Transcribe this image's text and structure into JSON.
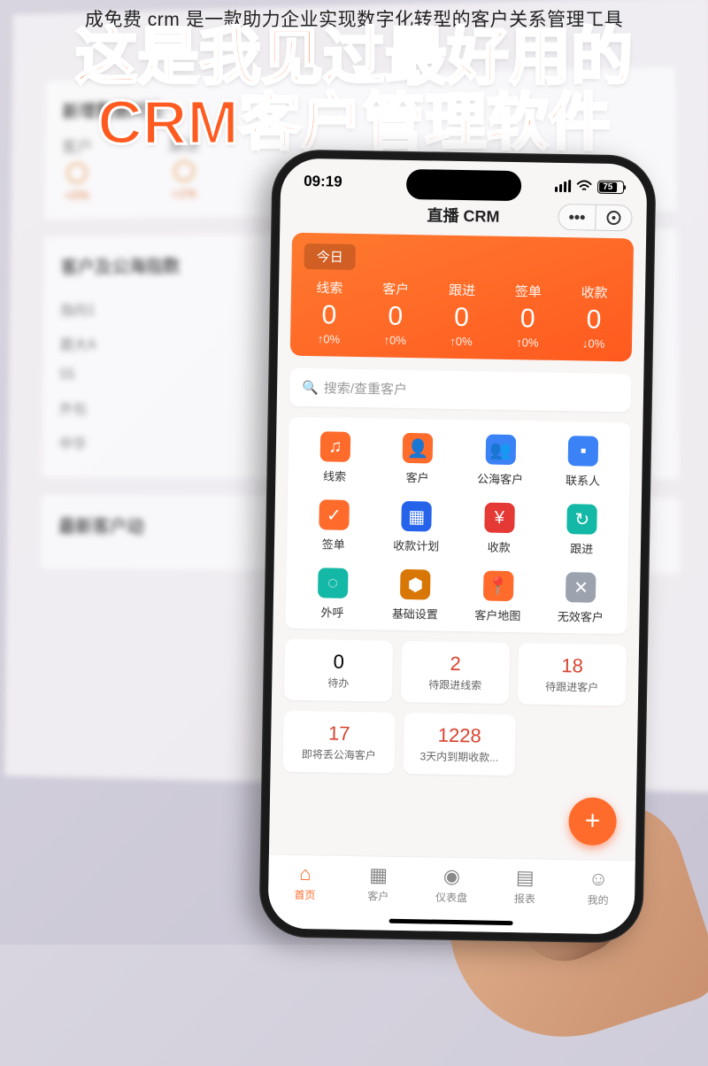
{
  "caption": {
    "small": "成免费 crm 是一款助力企业实现数字化转型的客户关系管理工具",
    "line1": "这是我见过最好用的",
    "line2": "CRM客户管理软件"
  },
  "bg": {
    "section1_title": "新增数据对比",
    "cols": [
      {
        "label": "客户",
        "pct": "+0%"
      },
      {
        "label": "跟进",
        "pct": "+1%"
      }
    ],
    "section2_title": "客户及公海指数",
    "rows": [
      "指向1",
      "跟大A",
      "55",
      "外包",
      "中华"
    ],
    "section3_title": "最新客户动"
  },
  "phone": {
    "status": {
      "time": "09:19",
      "battery": "75"
    },
    "app_title": "直播 CRM",
    "today_label": "今日",
    "stats": [
      {
        "label": "线索",
        "value": "0",
        "pct": "↑0%"
      },
      {
        "label": "客户",
        "value": "0",
        "pct": "↑0%"
      },
      {
        "label": "跟进",
        "value": "0",
        "pct": "↑0%"
      },
      {
        "label": "签单",
        "value": "0",
        "pct": "↑0%"
      },
      {
        "label": "收款",
        "value": "0",
        "pct": "↓0%"
      }
    ],
    "search_placeholder": "搜索/查重客户",
    "grid": [
      {
        "label": "线索",
        "icon": "♫",
        "color": "ic-orange"
      },
      {
        "label": "客户",
        "icon": "👤",
        "color": "ic-orange"
      },
      {
        "label": "公海客户",
        "icon": "👥",
        "color": "ic-blue"
      },
      {
        "label": "联系人",
        "icon": "▪",
        "color": "ic-blue"
      },
      {
        "label": "签单",
        "icon": "✓",
        "color": "ic-orange"
      },
      {
        "label": "收款计划",
        "icon": "▦",
        "color": "ic-dblue"
      },
      {
        "label": "收款",
        "icon": "¥",
        "color": "ic-red"
      },
      {
        "label": "跟进",
        "icon": "↻",
        "color": "ic-teal"
      },
      {
        "label": "外呼",
        "icon": "◌",
        "color": "ic-teal"
      },
      {
        "label": "基础设置",
        "icon": "⬢",
        "color": "ic-hex"
      },
      {
        "label": "客户地图",
        "icon": "📍",
        "color": "ic-orange"
      },
      {
        "label": "无效客户",
        "icon": "✕",
        "color": "ic-grey"
      }
    ],
    "cards1": [
      {
        "num": "0",
        "label": "待办",
        "red": false
      },
      {
        "num": "2",
        "label": "待跟进线索",
        "red": true
      },
      {
        "num": "18",
        "label": "待跟进客户",
        "red": true
      }
    ],
    "cards2": [
      {
        "num": "17",
        "label": "即将丢公海客户",
        "red": true
      },
      {
        "num": "1228",
        "label": "3天内到期收款...",
        "red": true
      }
    ],
    "tabs": [
      {
        "label": "首页",
        "icon": "⌂",
        "active": true
      },
      {
        "label": "客户",
        "icon": "▦",
        "active": false
      },
      {
        "label": "仪表盘",
        "icon": "◉",
        "active": false
      },
      {
        "label": "报表",
        "icon": "▤",
        "active": false
      },
      {
        "label": "我的",
        "icon": "☺",
        "active": false
      }
    ]
  }
}
